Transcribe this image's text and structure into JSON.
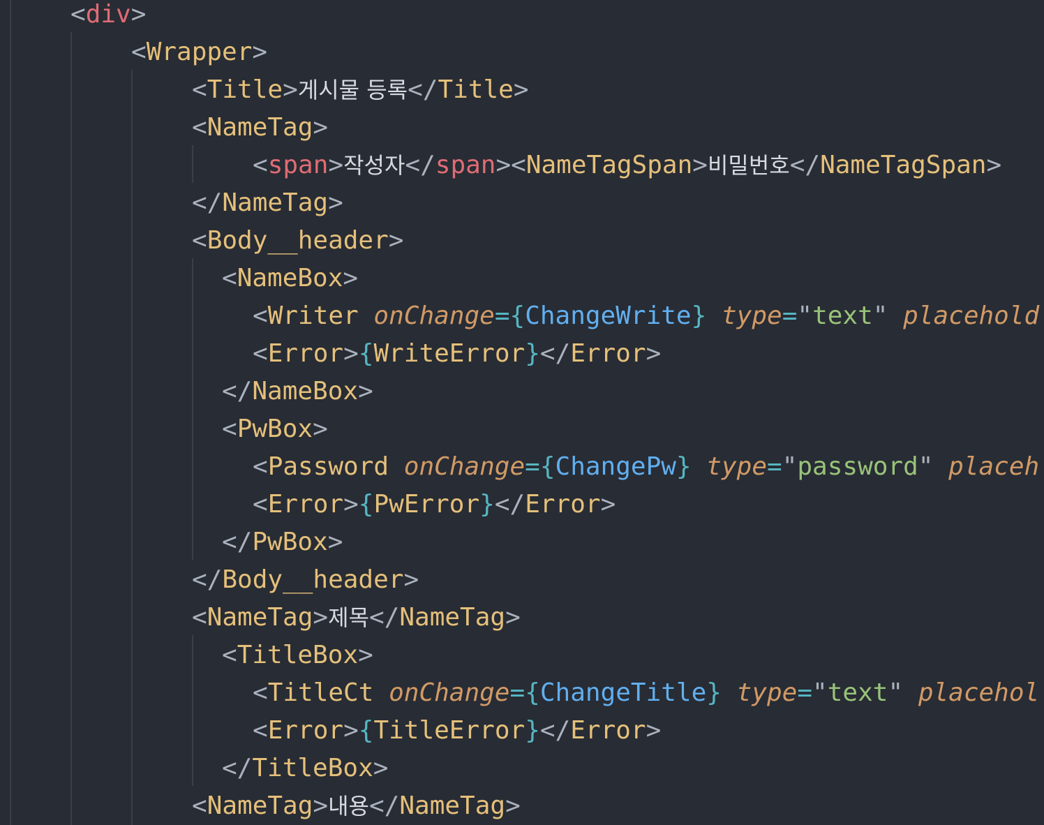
{
  "editor": {
    "lines": [
      {
        "tokens": [
          {
            "t": "<",
            "c": "pun"
          },
          {
            "t": "div",
            "c": "tag-html"
          },
          {
            "t": ">",
            "c": "pun"
          }
        ]
      },
      {
        "tokens": [
          {
            "t": "<",
            "c": "pun"
          },
          {
            "t": "Wrapper",
            "c": "tag-comp"
          },
          {
            "t": ">",
            "c": "pun"
          }
        ]
      },
      {
        "tokens": [
          {
            "t": "<",
            "c": "pun"
          },
          {
            "t": "Title",
            "c": "tag-comp"
          },
          {
            "t": ">",
            "c": "pun"
          },
          {
            "t": "게시물 등록",
            "c": "txt ko"
          },
          {
            "t": "</",
            "c": "pun"
          },
          {
            "t": "Title",
            "c": "tag-comp"
          },
          {
            "t": ">",
            "c": "pun"
          }
        ]
      },
      {
        "tokens": [
          {
            "t": "<",
            "c": "pun"
          },
          {
            "t": "NameTag",
            "c": "tag-comp"
          },
          {
            "t": ">",
            "c": "pun"
          }
        ]
      },
      {
        "tokens": [
          {
            "t": "<",
            "c": "pun"
          },
          {
            "t": "span",
            "c": "tag-html"
          },
          {
            "t": ">",
            "c": "pun"
          },
          {
            "t": "작성자",
            "c": "txt ko"
          },
          {
            "t": "</",
            "c": "pun"
          },
          {
            "t": "span",
            "c": "tag-html"
          },
          {
            "t": "><",
            "c": "pun"
          },
          {
            "t": "NameTagSpan",
            "c": "tag-comp"
          },
          {
            "t": ">",
            "c": "pun"
          },
          {
            "t": "비밀번호",
            "c": "txt ko"
          },
          {
            "t": "</",
            "c": "pun"
          },
          {
            "t": "NameTagSpan",
            "c": "tag-comp"
          },
          {
            "t": ">",
            "c": "pun"
          }
        ]
      },
      {
        "tokens": [
          {
            "t": "</",
            "c": "pun"
          },
          {
            "t": "NameTag",
            "c": "tag-comp"
          },
          {
            "t": ">",
            "c": "pun"
          }
        ]
      },
      {
        "tokens": [
          {
            "t": "<",
            "c": "pun"
          },
          {
            "t": "Body__header",
            "c": "tag-comp"
          },
          {
            "t": ">",
            "c": "pun"
          }
        ]
      },
      {
        "tokens": [
          {
            "t": "<",
            "c": "pun"
          },
          {
            "t": "NameBox",
            "c": "tag-comp"
          },
          {
            "t": ">",
            "c": "pun"
          }
        ]
      },
      {
        "tokens": [
          {
            "t": "<",
            "c": "pun"
          },
          {
            "t": "Writer",
            "c": "tag-comp"
          },
          {
            "t": " ",
            "c": "pun"
          },
          {
            "t": "onChange",
            "c": "attr"
          },
          {
            "t": "=",
            "c": "brace"
          },
          {
            "t": "{",
            "c": "brace"
          },
          {
            "t": "ChangeWrite",
            "c": "var"
          },
          {
            "t": "}",
            "c": "brace"
          },
          {
            "t": " ",
            "c": "pun"
          },
          {
            "t": "type",
            "c": "attr"
          },
          {
            "t": "=",
            "c": "brace"
          },
          {
            "t": "\"",
            "c": "pun"
          },
          {
            "t": "text",
            "c": "str"
          },
          {
            "t": "\"",
            "c": "pun"
          },
          {
            "t": " ",
            "c": "pun"
          },
          {
            "t": "placehold",
            "c": "attr"
          }
        ]
      },
      {
        "tokens": [
          {
            "t": "<",
            "c": "pun"
          },
          {
            "t": "Error",
            "c": "tag-comp"
          },
          {
            "t": ">",
            "c": "pun"
          },
          {
            "t": "{",
            "c": "brace"
          },
          {
            "t": "WriteError",
            "c": "tag-comp"
          },
          {
            "t": "}",
            "c": "brace"
          },
          {
            "t": "</",
            "c": "pun"
          },
          {
            "t": "Error",
            "c": "tag-comp"
          },
          {
            "t": ">",
            "c": "pun"
          }
        ]
      },
      {
        "tokens": [
          {
            "t": "</",
            "c": "pun"
          },
          {
            "t": "NameBox",
            "c": "tag-comp"
          },
          {
            "t": ">",
            "c": "pun"
          }
        ]
      },
      {
        "tokens": [
          {
            "t": "<",
            "c": "pun"
          },
          {
            "t": "PwBox",
            "c": "tag-comp"
          },
          {
            "t": ">",
            "c": "pun"
          }
        ]
      },
      {
        "tokens": [
          {
            "t": "<",
            "c": "pun"
          },
          {
            "t": "Password",
            "c": "tag-comp"
          },
          {
            "t": " ",
            "c": "pun"
          },
          {
            "t": "onChange",
            "c": "attr"
          },
          {
            "t": "=",
            "c": "brace"
          },
          {
            "t": "{",
            "c": "brace"
          },
          {
            "t": "ChangePw",
            "c": "var"
          },
          {
            "t": "}",
            "c": "brace"
          },
          {
            "t": " ",
            "c": "pun"
          },
          {
            "t": "type",
            "c": "attr"
          },
          {
            "t": "=",
            "c": "brace"
          },
          {
            "t": "\"",
            "c": "pun"
          },
          {
            "t": "password",
            "c": "str"
          },
          {
            "t": "\"",
            "c": "pun"
          },
          {
            "t": " ",
            "c": "pun"
          },
          {
            "t": "placeh",
            "c": "attr"
          }
        ]
      },
      {
        "tokens": [
          {
            "t": "<",
            "c": "pun"
          },
          {
            "t": "Error",
            "c": "tag-comp"
          },
          {
            "t": ">",
            "c": "pun"
          },
          {
            "t": "{",
            "c": "brace"
          },
          {
            "t": "PwError",
            "c": "tag-comp"
          },
          {
            "t": "}",
            "c": "brace"
          },
          {
            "t": "</",
            "c": "pun"
          },
          {
            "t": "Error",
            "c": "tag-comp"
          },
          {
            "t": ">",
            "c": "pun"
          }
        ]
      },
      {
        "tokens": [
          {
            "t": "</",
            "c": "pun"
          },
          {
            "t": "PwBox",
            "c": "tag-comp"
          },
          {
            "t": ">",
            "c": "pun"
          }
        ]
      },
      {
        "tokens": [
          {
            "t": "</",
            "c": "pun"
          },
          {
            "t": "Body__header",
            "c": "tag-comp"
          },
          {
            "t": ">",
            "c": "pun"
          }
        ]
      },
      {
        "tokens": [
          {
            "t": "<",
            "c": "pun"
          },
          {
            "t": "NameTag",
            "c": "tag-comp"
          },
          {
            "t": ">",
            "c": "pun"
          },
          {
            "t": "제목",
            "c": "txt ko"
          },
          {
            "t": "</",
            "c": "pun"
          },
          {
            "t": "NameTag",
            "c": "tag-comp"
          },
          {
            "t": ">",
            "c": "pun"
          }
        ]
      },
      {
        "tokens": [
          {
            "t": "<",
            "c": "pun"
          },
          {
            "t": "TitleBox",
            "c": "tag-comp"
          },
          {
            "t": ">",
            "c": "pun"
          }
        ]
      },
      {
        "tokens": [
          {
            "t": "<",
            "c": "pun"
          },
          {
            "t": "TitleCt",
            "c": "tag-comp"
          },
          {
            "t": " ",
            "c": "pun"
          },
          {
            "t": "onChange",
            "c": "attr"
          },
          {
            "t": "=",
            "c": "brace"
          },
          {
            "t": "{",
            "c": "brace"
          },
          {
            "t": "ChangeTitle",
            "c": "var"
          },
          {
            "t": "}",
            "c": "brace"
          },
          {
            "t": " ",
            "c": "pun"
          },
          {
            "t": "type",
            "c": "attr"
          },
          {
            "t": "=",
            "c": "brace"
          },
          {
            "t": "\"",
            "c": "pun"
          },
          {
            "t": "text",
            "c": "str"
          },
          {
            "t": "\"",
            "c": "pun"
          },
          {
            "t": " ",
            "c": "pun"
          },
          {
            "t": "placehol",
            "c": "attr"
          }
        ]
      },
      {
        "tokens": [
          {
            "t": "<",
            "c": "pun"
          },
          {
            "t": "Error",
            "c": "tag-comp"
          },
          {
            "t": ">",
            "c": "pun"
          },
          {
            "t": "{",
            "c": "brace"
          },
          {
            "t": "TitleError",
            "c": "tag-comp"
          },
          {
            "t": "}",
            "c": "brace"
          },
          {
            "t": "</",
            "c": "pun"
          },
          {
            "t": "Error",
            "c": "tag-comp"
          },
          {
            "t": ">",
            "c": "pun"
          }
        ]
      },
      {
        "tokens": [
          {
            "t": "</",
            "c": "pun"
          },
          {
            "t": "TitleBox",
            "c": "tag-comp"
          },
          {
            "t": ">",
            "c": "pun"
          }
        ]
      },
      {
        "tokens": [
          {
            "t": "<",
            "c": "pun"
          },
          {
            "t": "NameTag",
            "c": "tag-comp"
          },
          {
            "t": ">",
            "c": "pun"
          },
          {
            "t": "내용",
            "c": "txt ko"
          },
          {
            "t": "</",
            "c": "pun"
          },
          {
            "t": "NameTag",
            "c": "tag-comp"
          },
          {
            "t": ">",
            "c": "pun"
          }
        ]
      }
    ]
  },
  "theme": {
    "background": "#282c34",
    "indent_guide": "#3b4048",
    "punctuation": "#abb2bf",
    "html_tag": "#e06c75",
    "component_tag": "#e5c07b",
    "attribute": "#d19a66",
    "string": "#98c379",
    "brace": "#56b6c2",
    "variable": "#61afef"
  }
}
